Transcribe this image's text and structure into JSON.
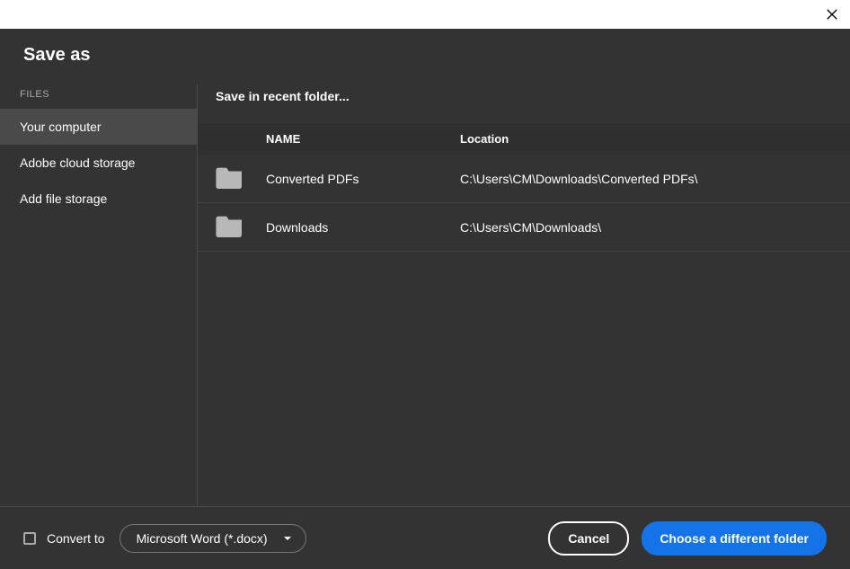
{
  "dialog": {
    "title": "Save as"
  },
  "sidebar": {
    "section_label": "FILES",
    "items": [
      {
        "label": "Your computer",
        "active": true
      },
      {
        "label": "Adobe cloud storage",
        "active": false
      },
      {
        "label": "Add file storage",
        "active": false
      }
    ]
  },
  "main": {
    "heading": "Save in recent folder...",
    "columns": {
      "name": "NAME",
      "location": "Location"
    },
    "rows": [
      {
        "name": "Converted PDFs",
        "location": "C:\\Users\\CM\\Downloads\\Converted PDFs\\"
      },
      {
        "name": "Downloads",
        "location": "C:\\Users\\CM\\Downloads\\"
      }
    ]
  },
  "footer": {
    "convert_label": "Convert to",
    "format_selected": "Microsoft Word (*.docx)",
    "cancel_label": "Cancel",
    "choose_folder_label": "Choose a different folder"
  }
}
